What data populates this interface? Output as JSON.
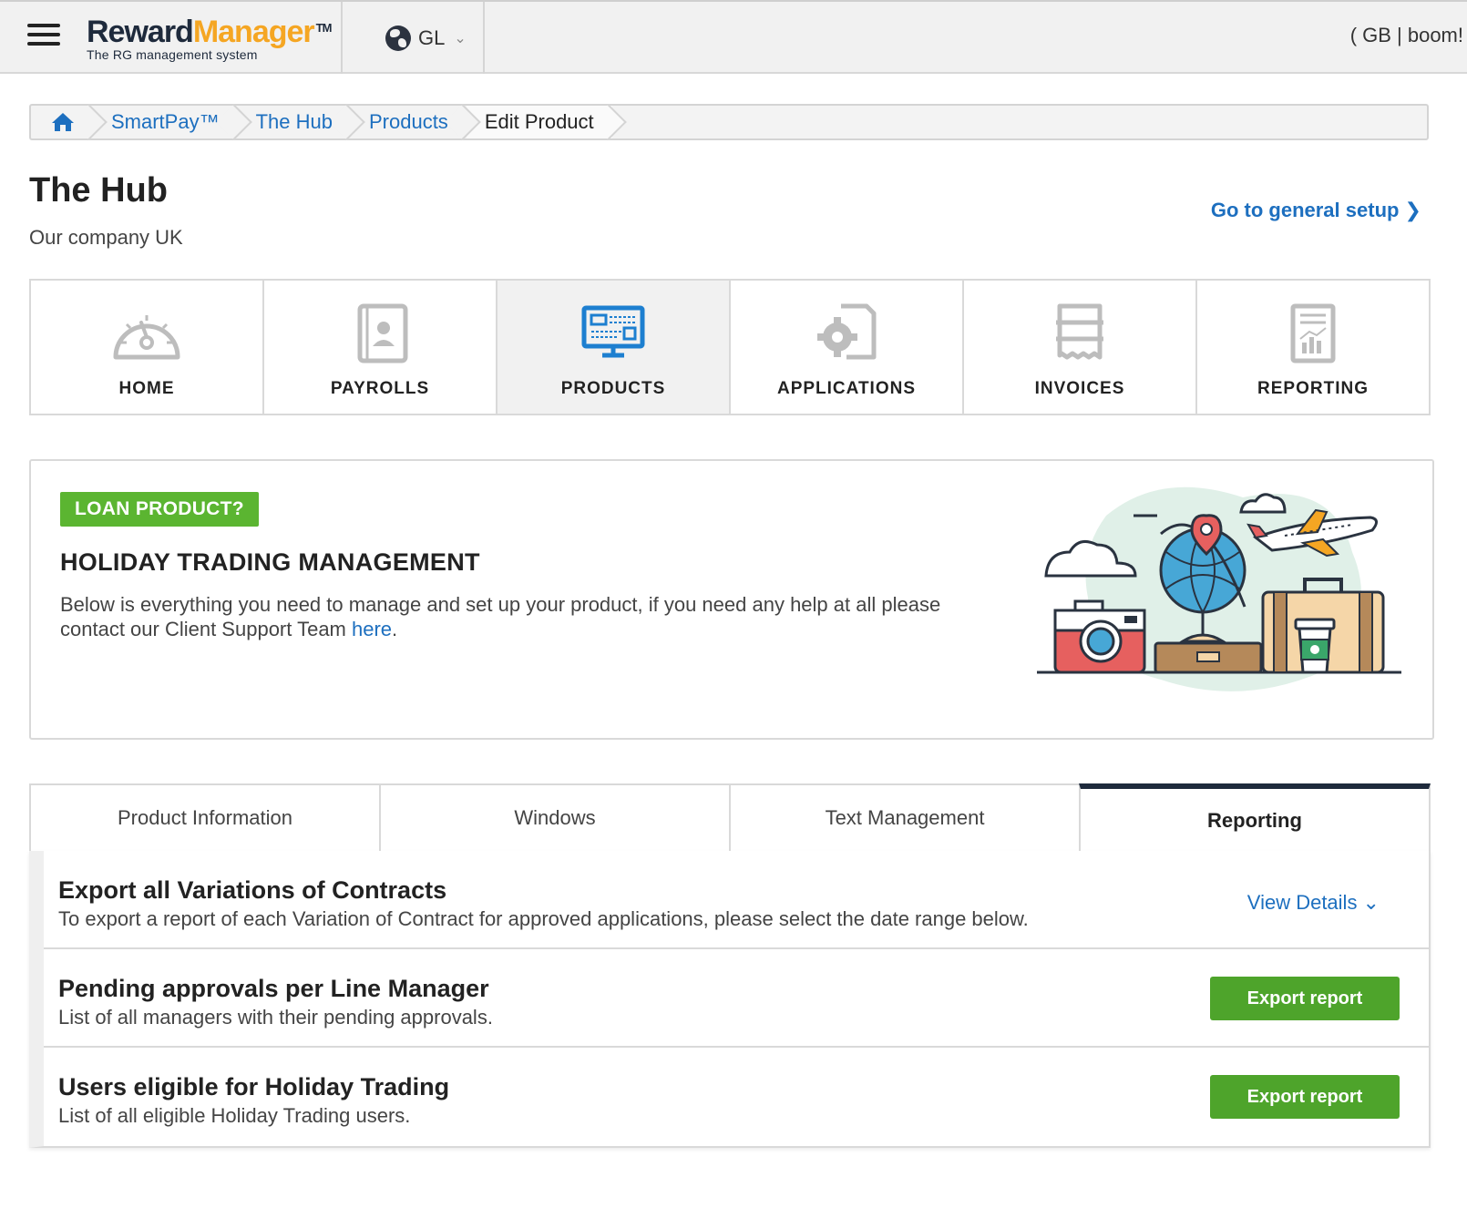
{
  "topbar": {
    "logo_reward": "Reward",
    "logo_manager": "Manager",
    "logo_tm": "TM",
    "logo_subtitle": "The RG management system",
    "region_label": "GL",
    "user_info": "( GB | boom!"
  },
  "breadcrumb": {
    "items": [
      "SmartPay™",
      "The Hub",
      "Products"
    ],
    "current": "Edit Product"
  },
  "header": {
    "title": "The Hub",
    "subtitle": "Our company UK",
    "general_setup_label": "Go to general setup ❯"
  },
  "modules": [
    {
      "label": "HOME",
      "icon": "dashboard-gauge-icon"
    },
    {
      "label": "PAYROLLS",
      "icon": "contact-book-icon"
    },
    {
      "label": "PRODUCTS",
      "icon": "monitor-icon",
      "active": true
    },
    {
      "label": "APPLICATIONS",
      "icon": "gear-document-icon"
    },
    {
      "label": "INVOICES",
      "icon": "receipt-icon"
    },
    {
      "label": "REPORTING",
      "icon": "report-chart-icon"
    }
  ],
  "product": {
    "badge": "LOAN PRODUCT?",
    "heading": "HOLIDAY TRADING MANAGEMENT",
    "description_prefix": "Below is everything you need to manage and set up your product, if you need any help at all please contact our Client Support Team ",
    "description_link": "here",
    "description_suffix": "."
  },
  "tabs": [
    {
      "label": "Product Information"
    },
    {
      "label": "Windows"
    },
    {
      "label": "Text Management"
    },
    {
      "label": "Reporting",
      "active": true
    }
  ],
  "reports": [
    {
      "title": "Export all Variations of Contracts",
      "description": "To export a report of each Variation of Contract for approved applications, please select the date range below.",
      "action_label": "View Details ⌄"
    },
    {
      "title": "Pending approvals per Line Manager",
      "description": "List of all managers with their pending approvals.",
      "action_label": "Export report"
    },
    {
      "title": "Users eligible for Holiday Trading",
      "description": "List of all eligible Holiday Trading users.",
      "action_label": "Export report"
    }
  ],
  "colors": {
    "link": "#1d6fbf",
    "green": "#4ea42b",
    "badge_green": "#5bb531",
    "logo_orange": "#f5a623",
    "dark_navy": "#1e2a3c"
  }
}
